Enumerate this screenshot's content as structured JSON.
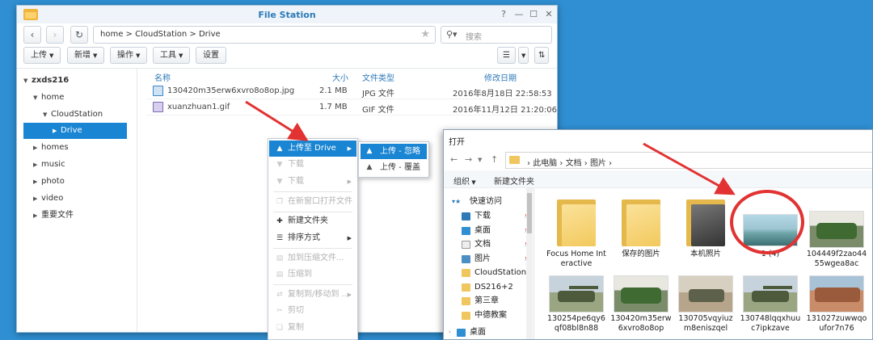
{
  "file_station": {
    "title": "File Station",
    "path_home": "home",
    "path_cloud": "CloudStation",
    "path_drive": "Drive",
    "search_placeholder": "搜索",
    "toolbar": {
      "upload": "上传",
      "create": "新增",
      "action": "操作",
      "tools": "工具",
      "settings": "设置"
    },
    "tree": {
      "root": "zxds216",
      "home": "home",
      "cloudstation": "CloudStation",
      "drive": "Drive",
      "homes": "homes",
      "music": "music",
      "photo": "photo",
      "video": "video",
      "important": "重要文件"
    },
    "columns": {
      "name": "名称",
      "size": "大小",
      "type": "文件类型",
      "modified": "修改日期"
    },
    "files": [
      {
        "name": "130420m35erw6xvro8o8op.jpg",
        "size": "2.1 MB",
        "type": "JPG 文件",
        "modified": "2016年8月18日 22:58:53"
      },
      {
        "name": "xuanzhuan1.gif",
        "size": "1.7 MB",
        "type": "GIF 文件",
        "modified": "2016年11月12日 21:20:06"
      }
    ]
  },
  "context_menu": {
    "upload_to": "上传至 Drive",
    "download1": "下载",
    "download2": "下载",
    "open_new_window": "在新窗口打开文件",
    "new_folder": "新建文件夹",
    "sort": "排序方式",
    "add_archive": "加到压缩文件...",
    "compress_to": "压缩到",
    "copy_move": "复制到/移动到 ...",
    "cut": "剪切",
    "copy": "复制"
  },
  "submenu": {
    "skip": "上传 - 忽略",
    "overwrite": "上传 - 覆盖"
  },
  "open_dialog": {
    "title": "打开",
    "path": {
      "pc": "此电脑",
      "docs": "文档",
      "pictures": "图片"
    },
    "toolbar": {
      "organize": "组织",
      "new_folder": "新建文件夹"
    },
    "nav": {
      "quick_access": "快速访问",
      "downloads": "下载",
      "desktop": "桌面",
      "documents": "文档",
      "pictures": "图片",
      "cloudstation": "CloudStation",
      "ds216": "DS216+2",
      "chapter3": "第三章",
      "zdjc": "中德教案",
      "desktop2": "桌面"
    },
    "items": [
      {
        "label": "Focus Home Interactive"
      },
      {
        "label": "保存的图片"
      },
      {
        "label": "本机照片"
      },
      {
        "label": "1 (4)"
      },
      {
        "label": "104449f2zao4455wgea8ac"
      },
      {
        "label": "130254pe6qy6qf08bl8n88"
      },
      {
        "label": "130420m35erw6xvro8o8op"
      },
      {
        "label": "130705vqyiuzm8eniszqel"
      },
      {
        "label": "130748lqqxhuuc7ipkzave"
      },
      {
        "label": "131027zuwwqoufor7n76"
      }
    ]
  },
  "colors": {
    "accent": "#1985d3",
    "desktop": "#2f8fd2",
    "annotation": "#e23232"
  }
}
